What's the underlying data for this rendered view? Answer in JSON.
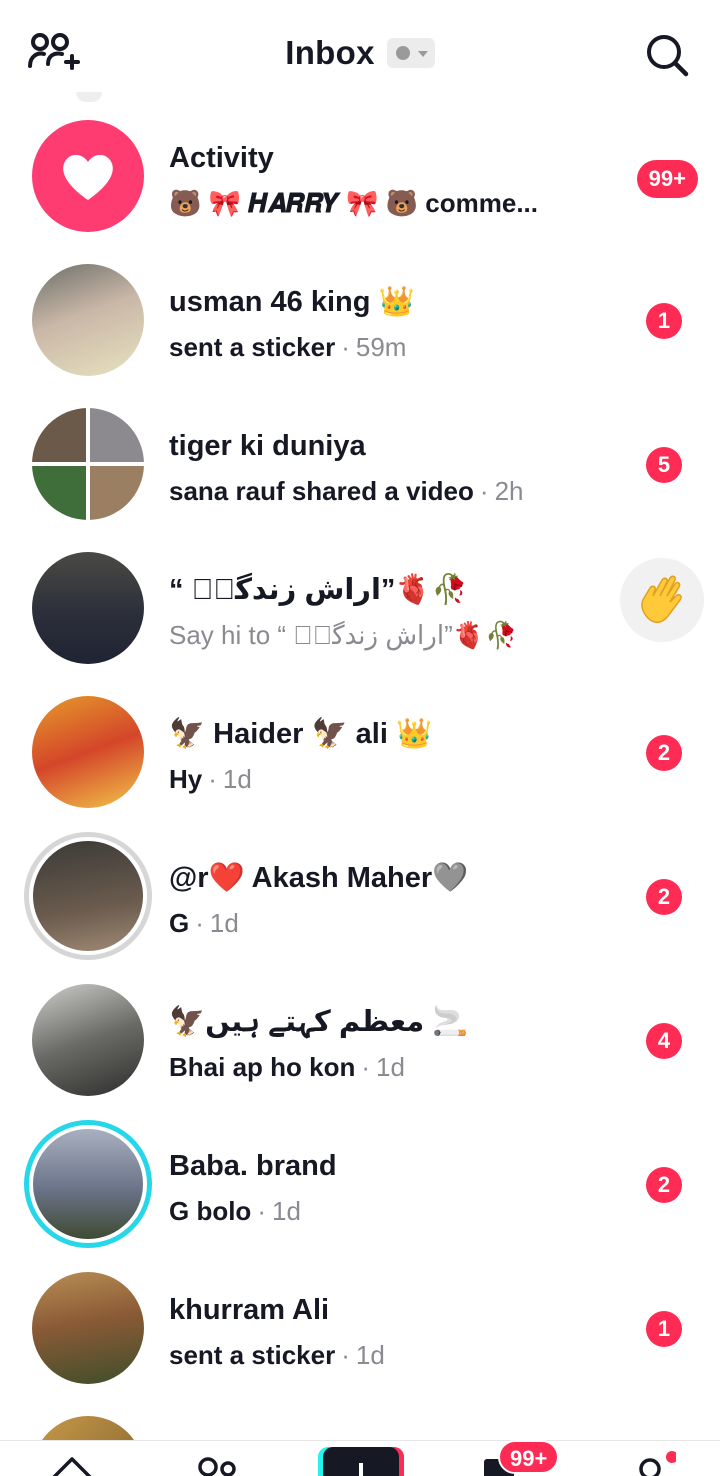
{
  "header": {
    "title": "Inbox",
    "add_friends_icon": "add-friends-icon",
    "search_icon": "search-icon",
    "status_icon": "status-dot-icon"
  },
  "activity": {
    "name": "Activity",
    "preview": "🐻 🎀 𝑯𝑨𝑹𝑹𝒀 🎀 🐻 comme...",
    "badge": "99+",
    "icon": "heart-icon"
  },
  "conversations": [
    {
      "name": "usman 46 king 👑",
      "message": "sent a sticker",
      "time": "59m",
      "badge": "1"
    },
    {
      "name": "tiger ki duniya",
      "message": "sana rauf shared a video",
      "time": "2h",
      "badge": "5"
    },
    {
      "name": "“ اراش زندگیؒ”🫀🥀",
      "message": "Say hi to “ اراش زندگیؒ”🫀🥀",
      "action": "wave-hand-icon"
    },
    {
      "name": "🦅 Haider 🦅 ali 👑",
      "message": "Hy",
      "time": "1d",
      "badge": "2"
    },
    {
      "name": "@r❤️ Akash Maher🩶",
      "message": "G",
      "time": "1d",
      "badge": "2"
    },
    {
      "name": "🦅معظم کہتے ہیں 🚬",
      "message": "Bhai ap ho kon",
      "time": "1d",
      "badge": "4"
    },
    {
      "name": "Baba. brand",
      "message": "G bolo",
      "time": "1d",
      "badge": "2"
    },
    {
      "name": "khurram Ali",
      "message": "sent a sticker",
      "time": "1d",
      "badge": "1"
    }
  ],
  "tabbar": {
    "inbox_badge": "99+",
    "tabs": [
      "home-icon",
      "friends-icon",
      "create-icon",
      "inbox-icon",
      "profile-icon"
    ]
  },
  "colors": {
    "accent": "#fe2c55",
    "activity": "#fe3c72",
    "story_ring_cyan": "#25d7e8"
  }
}
